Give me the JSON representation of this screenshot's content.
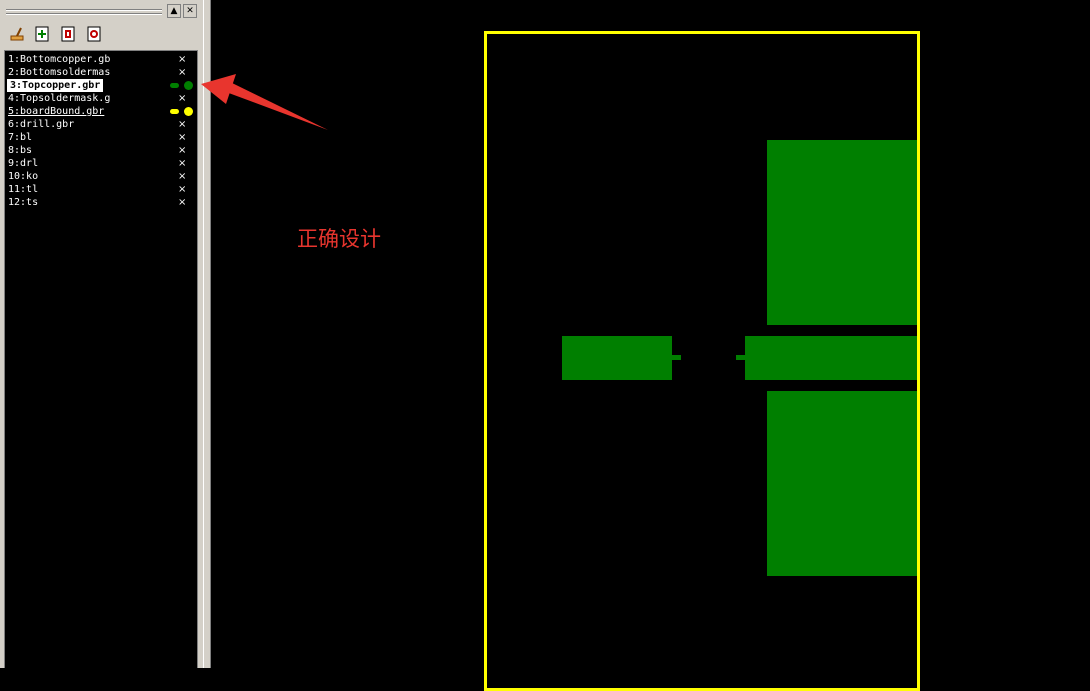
{
  "panel": {
    "minimize_label": "▲",
    "close_label": "✕"
  },
  "toolbar": {
    "buttons": [
      "clear-icon",
      "add-layer-icon",
      "reload-icon",
      "delete-icon"
    ]
  },
  "layers": [
    {
      "label": "1:Bottomcopper.gb",
      "status": "×"
    },
    {
      "label": "2:Bottomsoldermas",
      "status": "×"
    },
    {
      "label": "3:Topcopper.gbr",
      "active": true,
      "color": "#007f00"
    },
    {
      "label": "4:Topsoldermask.g",
      "status": "×"
    },
    {
      "label": "5:boardBound.gbr",
      "color": "#ffff00"
    },
    {
      "label": "6:drill.gbr",
      "status": "×"
    },
    {
      "label": "7:bl",
      "status": "×"
    },
    {
      "label": "8:bs",
      "status": "×"
    },
    {
      "label": "9:drl",
      "status": "×"
    },
    {
      "label": "10:ko",
      "status": "×"
    },
    {
      "label": "11:tl",
      "status": "×"
    },
    {
      "label": "12:ts",
      "status": "×"
    }
  ],
  "canvas": {
    "annotation": "正确设计",
    "annotation_color": "#e8352e",
    "copper_color": "#007f00",
    "outline_color": "#ffff00"
  }
}
